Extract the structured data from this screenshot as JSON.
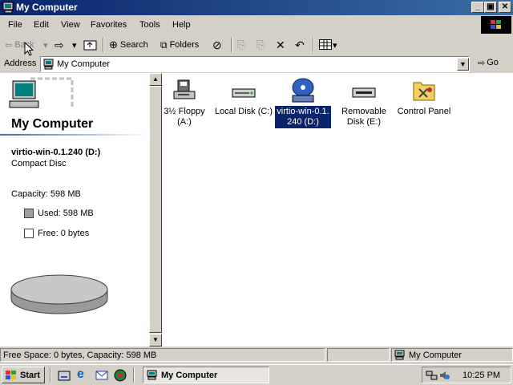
{
  "window": {
    "title": "My Computer"
  },
  "menubar": {
    "items": [
      "File",
      "Edit",
      "View",
      "Favorites",
      "Tools",
      "Help"
    ]
  },
  "toolbar": {
    "back": "Back",
    "search": "Search",
    "folders": "Folders"
  },
  "address": {
    "label": "Address",
    "value": "My Computer",
    "go": "Go"
  },
  "sidebar": {
    "heading": "My Computer",
    "item_name": "virtio-win-0.1.240 (D:)",
    "item_type": "Compact Disc",
    "capacity": "Capacity: 598 MB",
    "used": "Used: 598 MB",
    "free": "Free: 0 bytes"
  },
  "drives": [
    {
      "line1": "3½ Floppy",
      "line2": "(A:)",
      "icon": "floppy-drive-icon"
    },
    {
      "line1": "Local Disk (C:)",
      "line2": "",
      "icon": "hard-disk-icon"
    },
    {
      "line1": "virtio-win-0.1.",
      "line2": "240 (D:)",
      "icon": "cd-drive-icon",
      "selected": true
    },
    {
      "line1": "Removable",
      "line2": "Disk (E:)",
      "icon": "removable-disk-icon"
    },
    {
      "line1": "Control Panel",
      "line2": "",
      "icon": "control-panel-icon"
    }
  ],
  "status": {
    "text": "Free Space: 0 bytes, Capacity: 598 MB",
    "zone": "My Computer"
  },
  "taskbar": {
    "start": "Start",
    "task": "My Computer",
    "clock": "10:25 PM"
  },
  "colors": {
    "titlebar": "#0a246a",
    "selection": "#0a246a",
    "face": "#d4d0c8"
  }
}
